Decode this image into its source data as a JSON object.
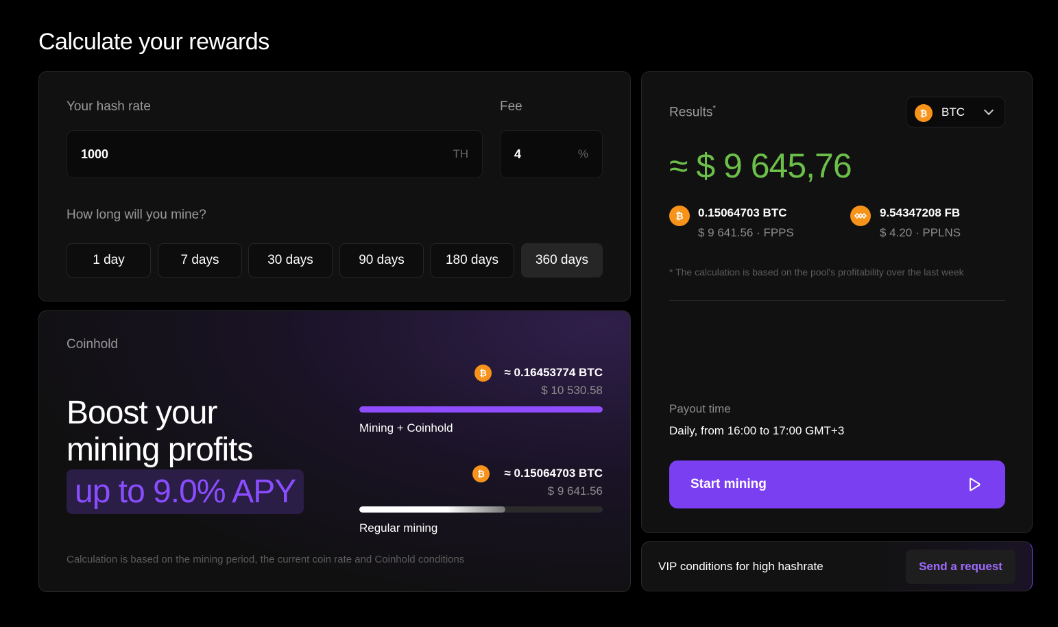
{
  "page": {
    "title": "Calculate your rewards"
  },
  "calculator": {
    "hash_rate_label": "Your hash rate",
    "hash_rate_value": "1000",
    "hash_rate_unit": "TH",
    "fee_label": "Fee",
    "fee_value": "4",
    "fee_unit": "%",
    "duration_label": "How long will you mine?",
    "periods": [
      "1 day",
      "7 days",
      "30 days",
      "90 days",
      "180 days",
      "360 days"
    ],
    "selected_period": "360 days"
  },
  "coinhold": {
    "label": "Coinhold",
    "headline_line1": "Boost your",
    "headline_line2": "mining profits",
    "apy": "up to 9.0% APY",
    "with_coinhold": {
      "amount": "≈ 0.16453774 BTC",
      "usd": "$ 10 530.58",
      "caption": "Mining + Coinhold",
      "fill_fraction": 1.0
    },
    "regular": {
      "amount": "≈ 0.15064703 BTC",
      "usd": "$ 9 641.56",
      "caption": "Regular mining",
      "fill_fraction": 0.6
    },
    "footnote": "Calculation is based on the mining period, the current coin rate and Coinhold conditions"
  },
  "results": {
    "label": "Results",
    "asterisk": "*",
    "coin": "BTC",
    "total": "≈ $ 9 645,76",
    "btc_amount": "0.15064703 BTC",
    "btc_sub": "$ 9 641.56 · FPPS",
    "fb_amount": "9.54347208 FB",
    "fb_sub": "$ 4.20 · PPLNS",
    "note": "* The calculation is based on the pool's profitability over the last week",
    "payout_label": "Payout time",
    "payout_value": "Daily, from 16:00 to 17:00 GMT+3",
    "start_button": "Start mining"
  },
  "vip": {
    "text": "VIP conditions for high hashrate",
    "button": "Send a request"
  },
  "colors": {
    "accent": "#7b3ff2",
    "total_green": "#6cc04a",
    "btc_orange": "#f7931a",
    "fb_orange": "#f7931a"
  },
  "icons": {
    "btc": "bitcoin-icon",
    "fb": "fractal-bitcoin-icon",
    "chevron": "chevron-down-icon",
    "play": "play-icon"
  }
}
